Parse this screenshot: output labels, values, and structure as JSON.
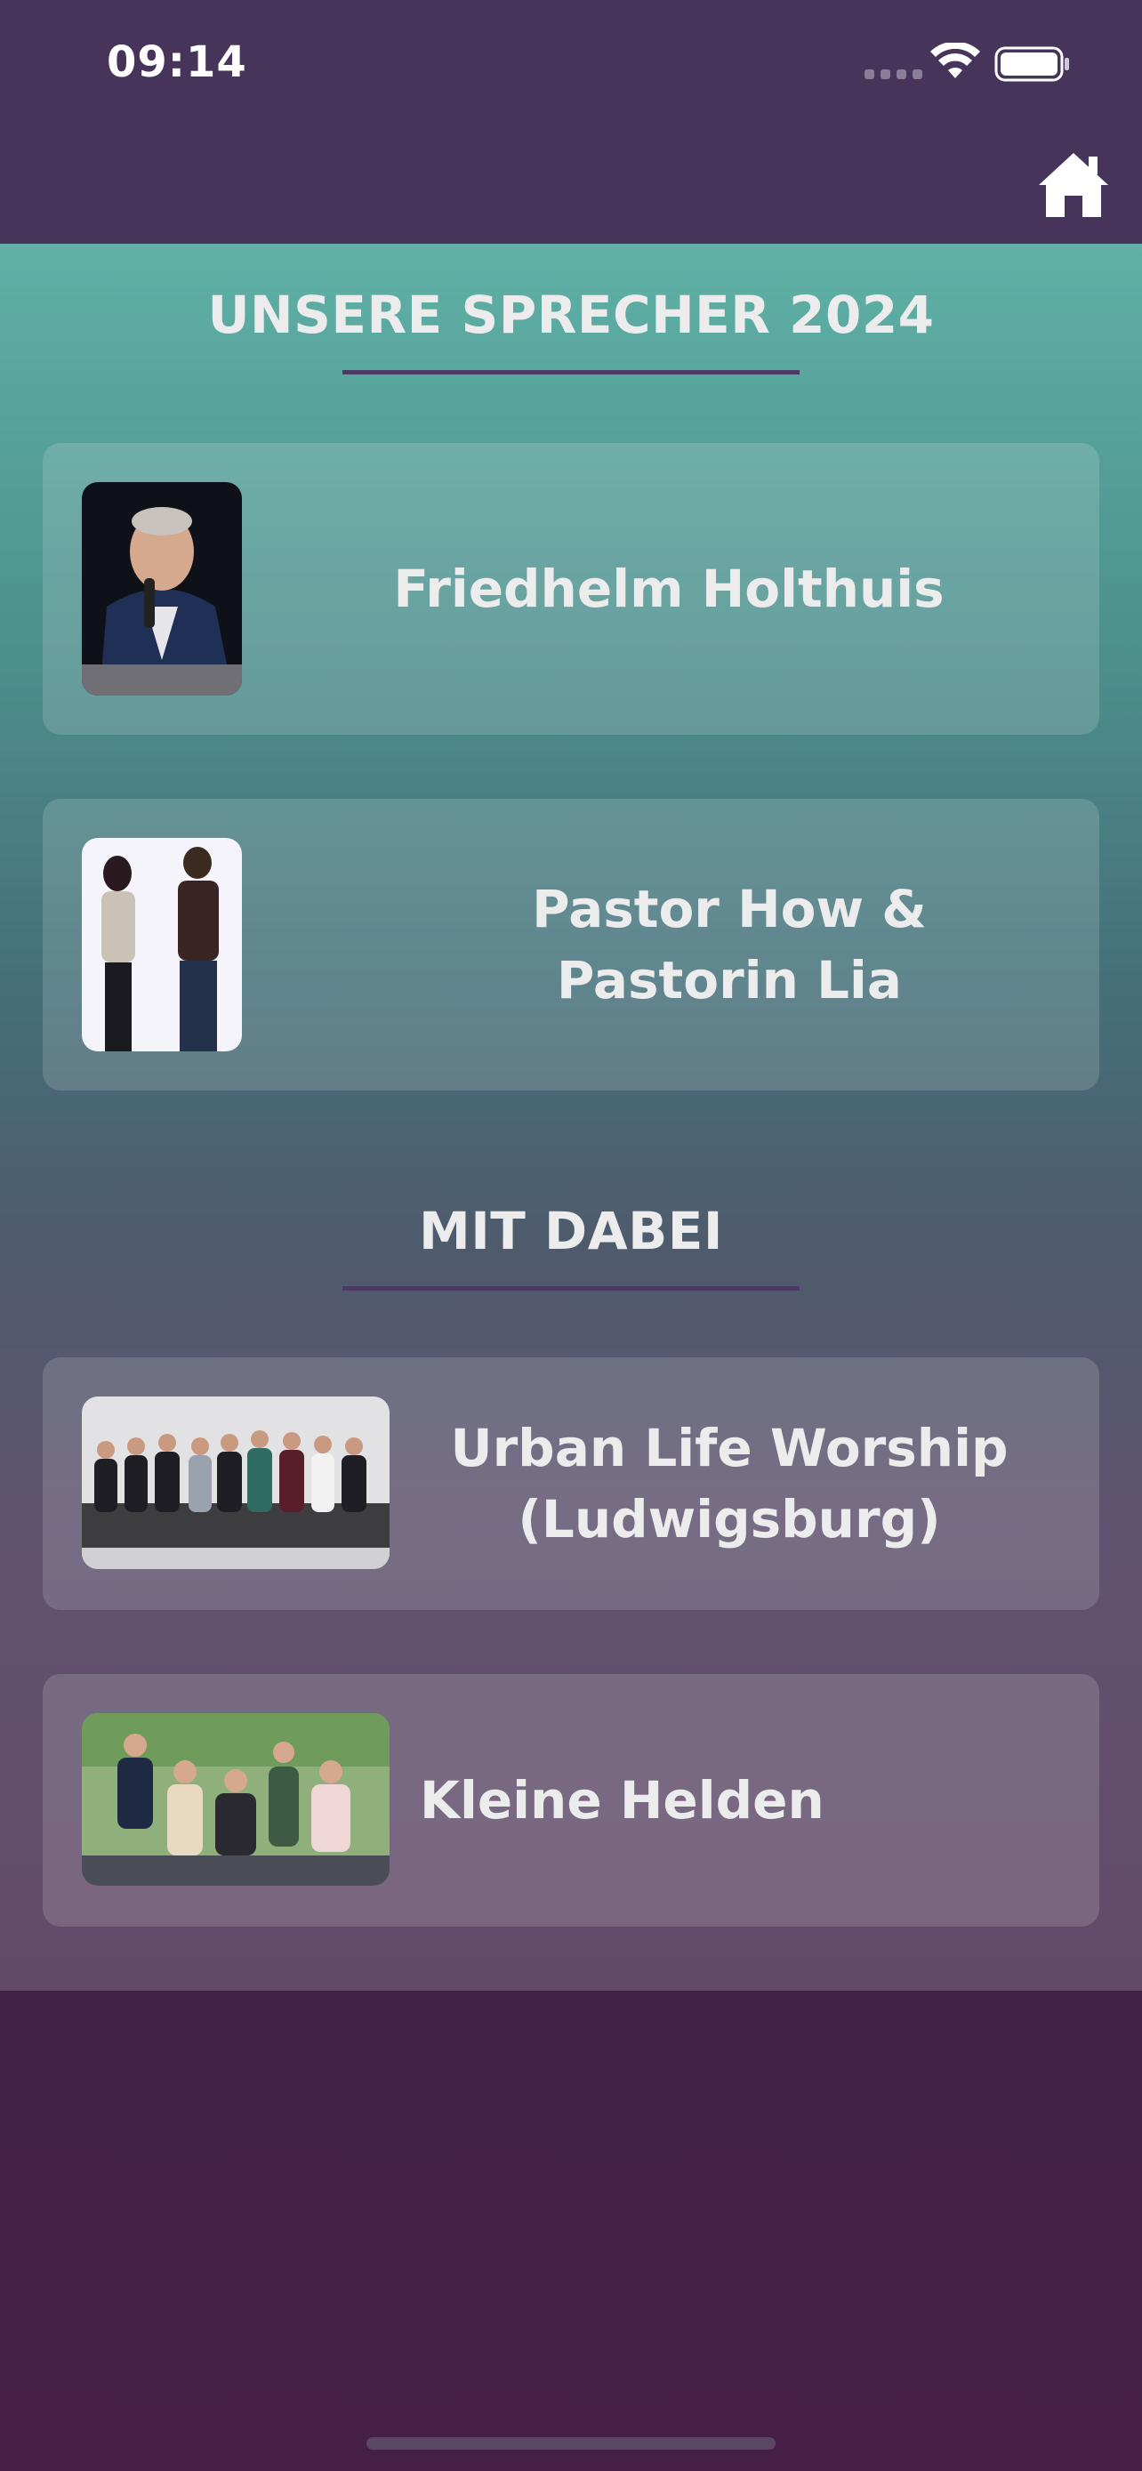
{
  "status_bar": {
    "time": "09:14"
  },
  "nav": {
    "home_icon": "home-icon"
  },
  "sections": {
    "speakers": {
      "title": "UNSERE SPRECHER 2024",
      "items": [
        {
          "name": "Friedhelm Holthuis",
          "photo": "speaker-photo"
        },
        {
          "name": "Pastor How & Pastorin Lia",
          "photo": "speaker-photo"
        }
      ]
    },
    "guests": {
      "title": "MIT DABEI",
      "items": [
        {
          "name": "Urban Life Worship (Ludwigsburg)",
          "photo": "group-photo"
        },
        {
          "name": "Kleine Helden",
          "photo": "group-photo"
        }
      ]
    }
  },
  "colors": {
    "header_bg": "#47345a",
    "accent_line": "#4a3a66",
    "text": "#ececec"
  }
}
